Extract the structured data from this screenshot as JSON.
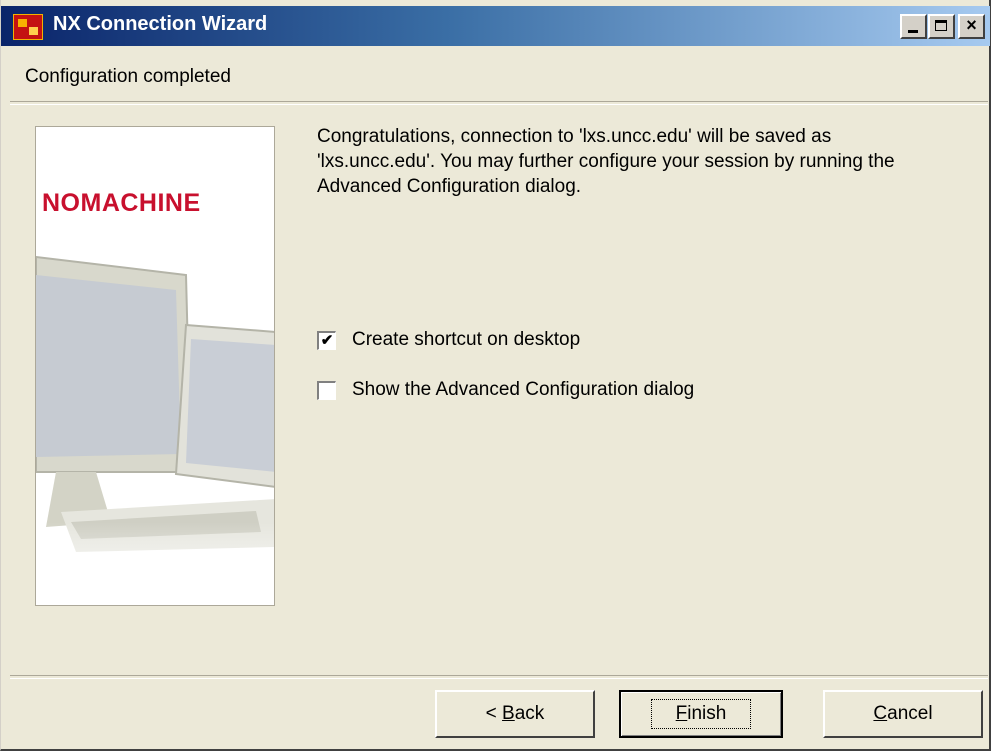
{
  "window": {
    "title": "NX Connection Wizard",
    "icon": "nx-app-icon",
    "controls": {
      "minimize": "minimize-icon",
      "maximize": "maximize-icon",
      "close": "×"
    }
  },
  "page": {
    "heading": "Configuration completed",
    "message": "Congratulations, connection to 'lxs.uncc.edu' will be saved as 'lxs.uncc.edu'. You may further configure your session by running the Advanced Configuration dialog."
  },
  "brand": {
    "logo_text": "NOMACHINE",
    "color": "#c8102e"
  },
  "options": [
    {
      "label": "Create shortcut on desktop",
      "checked": true,
      "mark": "✔"
    },
    {
      "label": "Show the Advanced Configuration dialog",
      "checked": false,
      "mark": ""
    }
  ],
  "buttons": {
    "back": {
      "prefix": "< ",
      "accel": "B",
      "rest": "ack"
    },
    "finish": {
      "accel": "F",
      "rest": "inish"
    },
    "cancel": {
      "accel": "C",
      "rest": "ancel"
    }
  },
  "colors": {
    "titlebar_start": "#0a246a",
    "titlebar_end": "#a6caf0",
    "dialog_bg": "#ece9d8"
  }
}
